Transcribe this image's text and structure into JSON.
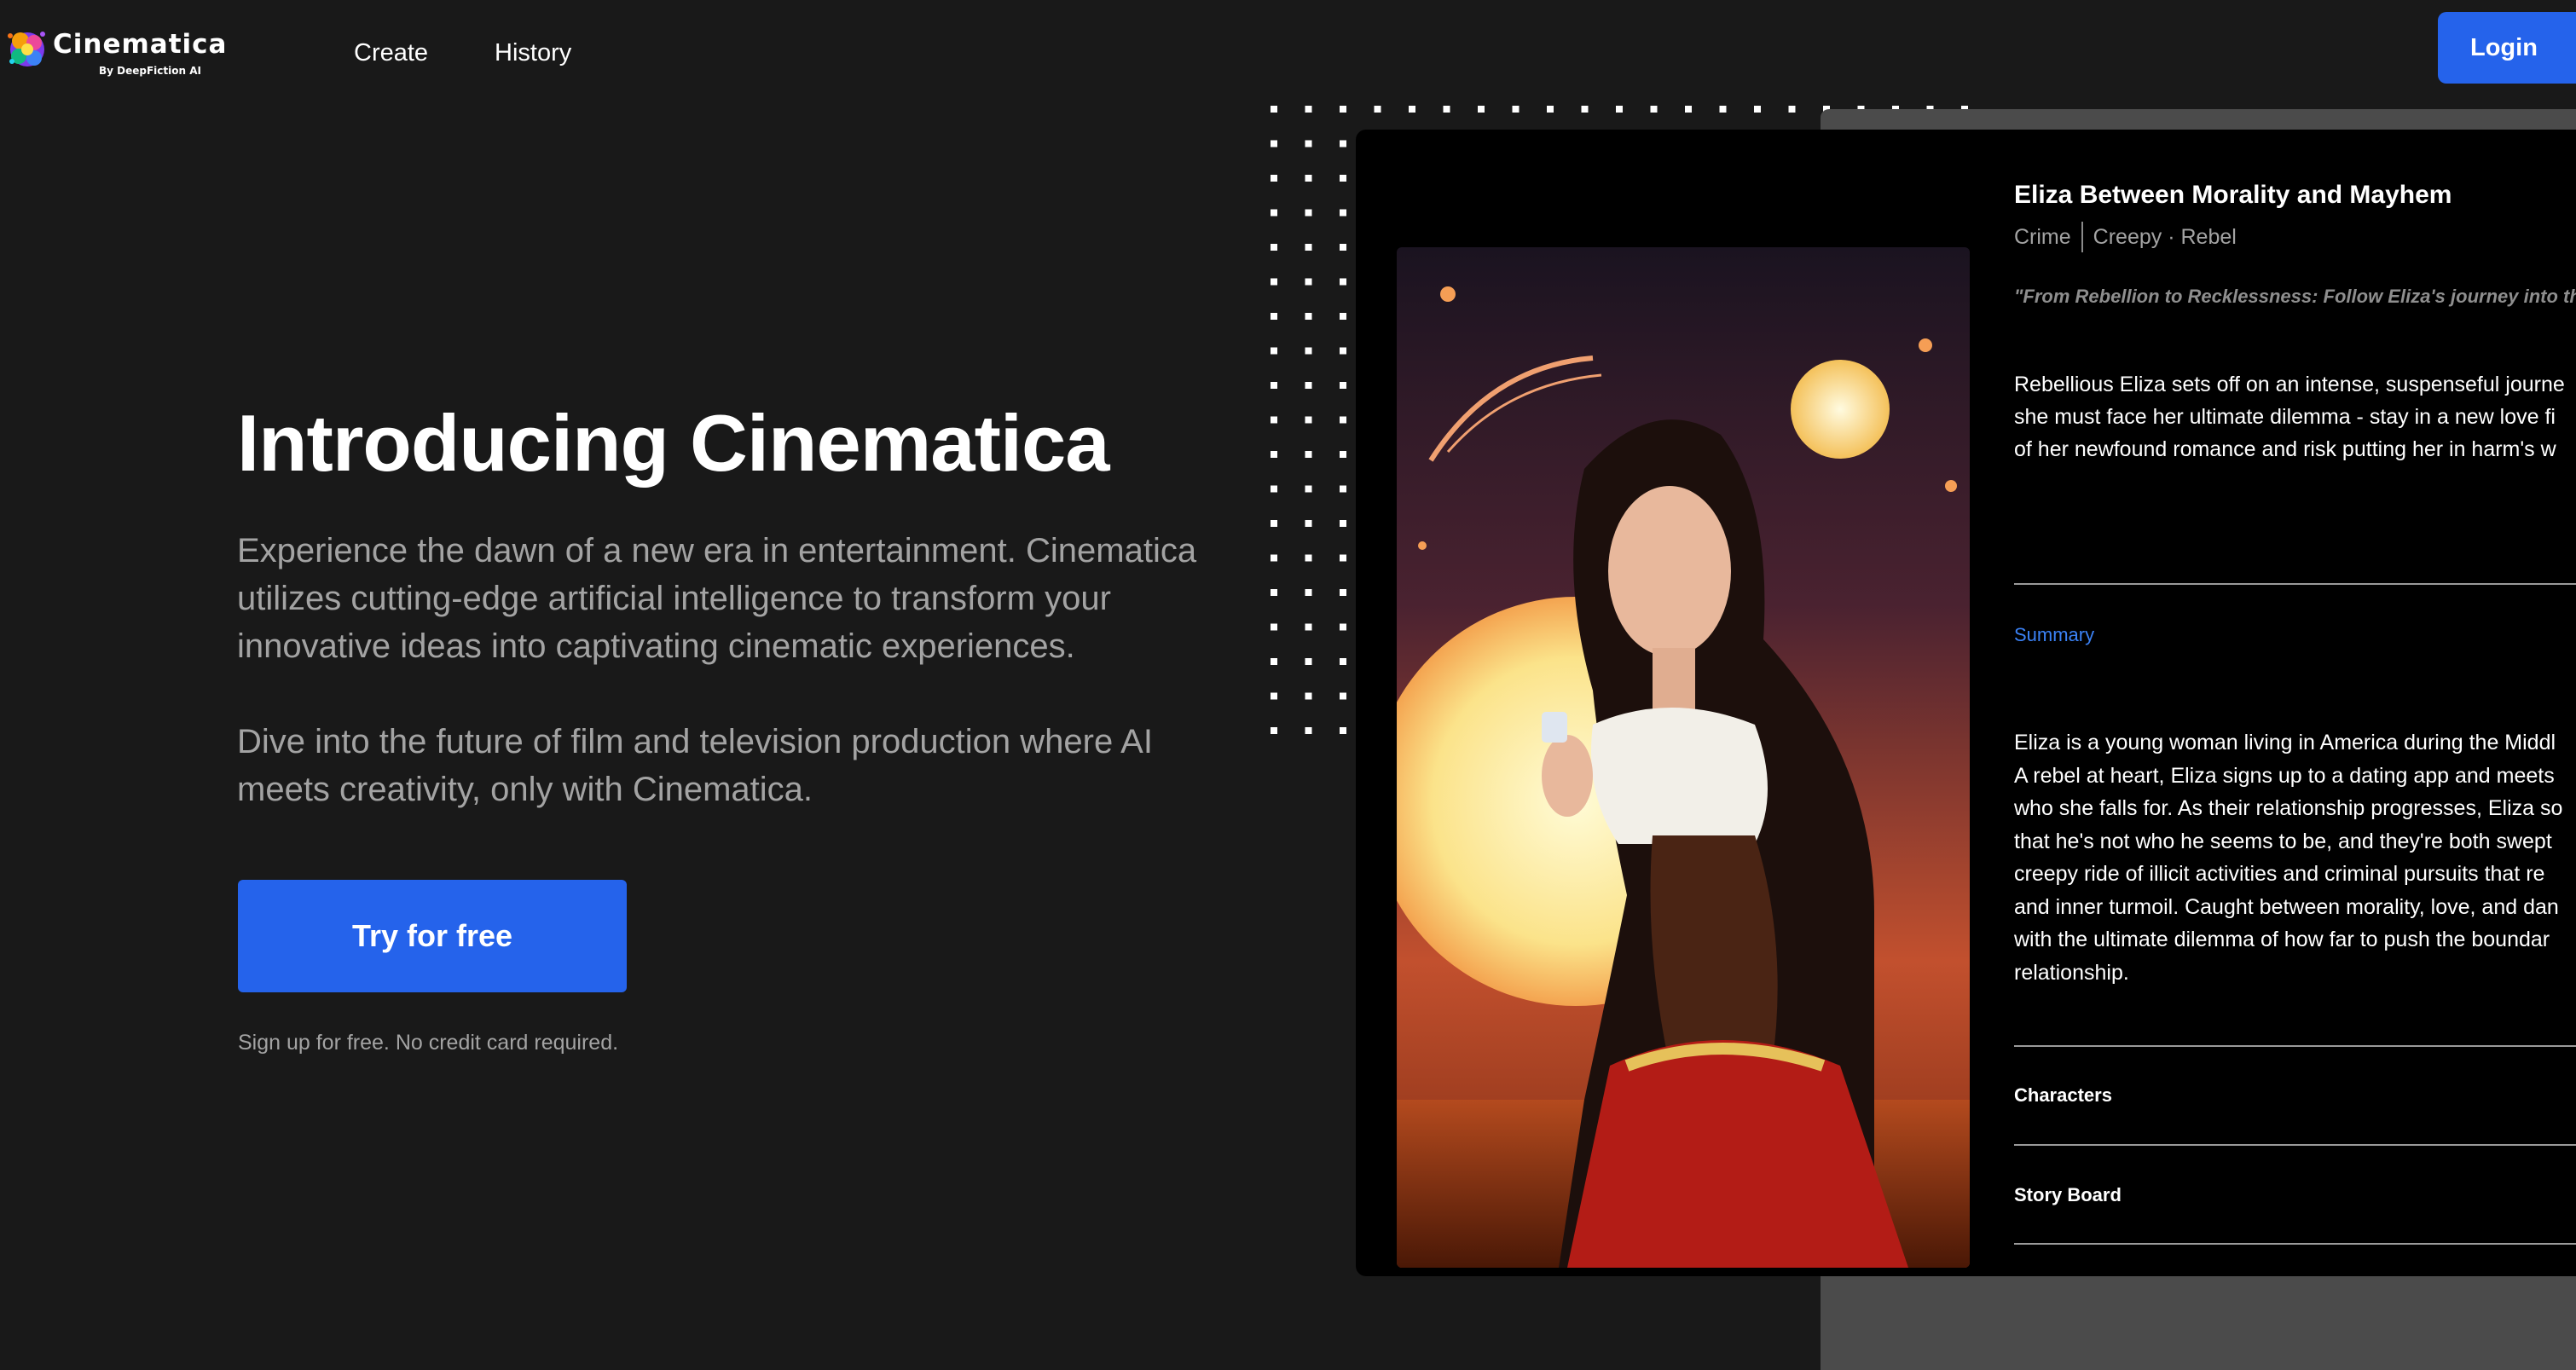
{
  "header": {
    "logo_name": "Cinematica",
    "logo_sub": "By DeepFiction AI",
    "nav": [
      {
        "label": "Create"
      },
      {
        "label": "History"
      }
    ],
    "login_label": "Login"
  },
  "hero": {
    "title": "Introducing Cinematica",
    "paragraph_1": "Experience the dawn of a new era in entertainment. Cinematica utilizes cutting-edge artificial intelligence to transform your innovative ideas into captivating cinematic experiences.",
    "paragraph_2": "Dive into the future of film and television production where AI meets creativity, only with Cinematica.",
    "cta_label": "Try for free",
    "cta_note": "Sign up for free. No credit card required."
  },
  "story_card": {
    "title": "Eliza Between Morality and Mayhem",
    "genre": "Crime",
    "tags": "Creepy · Rebel",
    "quote": "\"From Rebellion to Recklessness: Follow Eliza's journey into the",
    "intro_lines": [
      "Rebellious Eliza sets off on an intense, suspenseful journe",
      "she must face her ultimate dilemma - stay in a new love fi",
      "of her newfound romance and risk putting her in harm's w"
    ],
    "summary_label": "Summary",
    "summary_lines": [
      "Eliza is a young woman living in America during the Middl",
      "A rebel at heart, Eliza signs up to a dating app and meets",
      "who she falls for. As their relationship progresses, Eliza so",
      "that he's not who he seems to be, and they're both swept",
      "creepy ride of illicit activities and criminal pursuits that re",
      "and inner turmoil. Caught between morality, love, and dan",
      "with the ultimate dilemma of how far to push the boundar",
      "relationship."
    ],
    "characters_label": "Characters",
    "storyboard_label": "Story Board"
  },
  "colors": {
    "background": "#191919",
    "accent": "#2563eb",
    "link": "#3b82f6",
    "muted_text": "#a3a3a3",
    "card": "#000000"
  }
}
